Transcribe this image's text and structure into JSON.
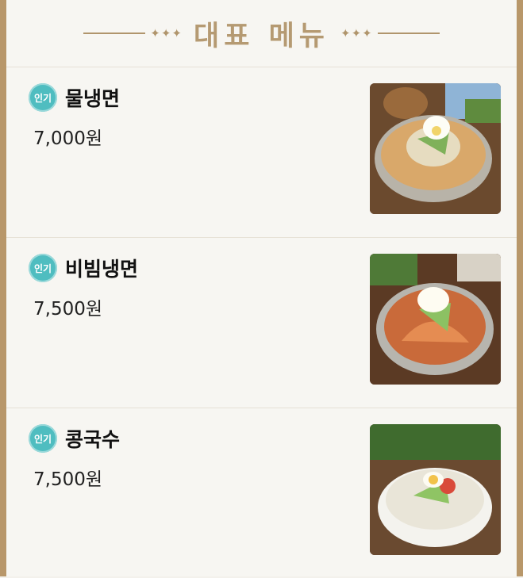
{
  "header": {
    "title": "대표 메뉴",
    "ornament_left": "✦✦✦",
    "ornament_right": "✦✦✦"
  },
  "menu": [
    {
      "badge": "인기",
      "name": "물냉면",
      "price": "7,000원",
      "image": "mul-naengmyeon-photo"
    },
    {
      "badge": "인기",
      "name": "비빔냉면",
      "price": "7,500원",
      "image": "bibim-naengmyeon-photo"
    },
    {
      "badge": "인기",
      "name": "콩국수",
      "price": "7,500원",
      "image": "kongguksu-photo"
    }
  ],
  "colors": {
    "frame": "#b8976a",
    "title": "#b59a72",
    "badge": "#4fbdc0"
  }
}
